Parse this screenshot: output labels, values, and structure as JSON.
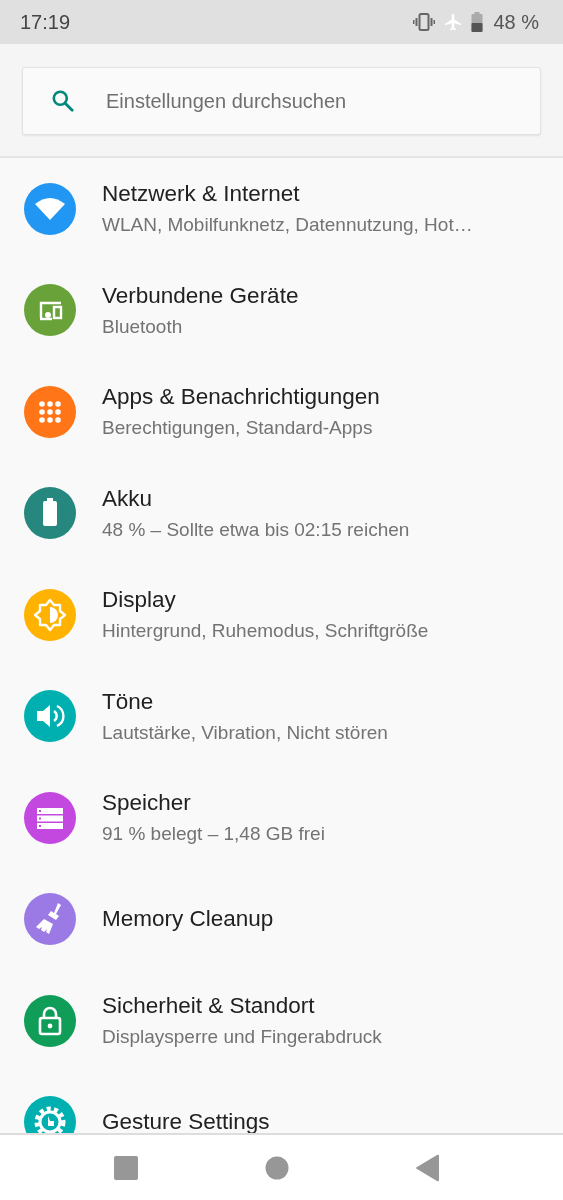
{
  "status_bar": {
    "time": "17:19",
    "battery_text": "48 %"
  },
  "search": {
    "placeholder": "Einstellungen durchsuchen"
  },
  "settings": [
    {
      "title": "Netzwerk & Internet",
      "subtitle": "WLAN, Mobilfunknetz, Datennutzung, Hot…",
      "color": "#2196f3"
    },
    {
      "title": "Verbundene Geräte",
      "subtitle": "Bluetooth",
      "color": "#6aa23a"
    },
    {
      "title": "Apps & Benachrichtigungen",
      "subtitle": "Berechtigungen, Standard-Apps",
      "color": "#ff7518"
    },
    {
      "title": "Akku",
      "subtitle": "48 % – Sollte etwa bis 02:15 reichen",
      "color": "#25877e"
    },
    {
      "title": "Display",
      "subtitle": "Hintergrund, Ruhemodus, Schriftgröße",
      "color": "#ffb300"
    },
    {
      "title": "Töne",
      "subtitle": "Lautstärke, Vibration, Nicht stören",
      "color": "#00b0b0"
    },
    {
      "title": "Speicher",
      "subtitle": "91 % belegt – 1,48 GB frei",
      "color": "#c348e0"
    },
    {
      "title": "Memory Cleanup",
      "color": "#9b7ae6"
    },
    {
      "title": "Sicherheit & Standort",
      "subtitle": "Displaysperre und Fingerabdruck",
      "color": "#0f9d58"
    },
    {
      "title": "Gesture Settings",
      "color": "#00b0b0"
    }
  ]
}
